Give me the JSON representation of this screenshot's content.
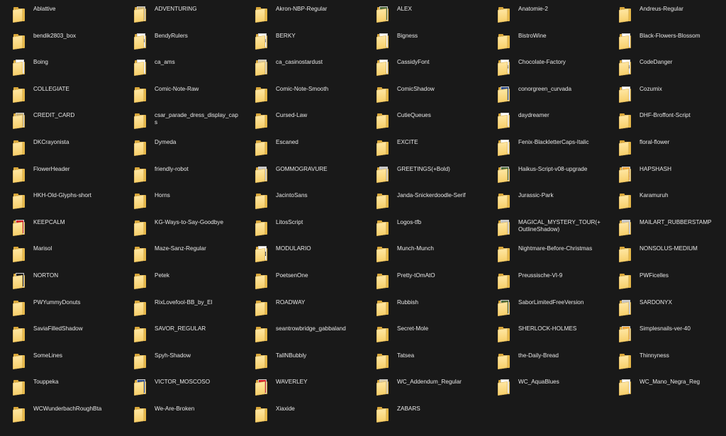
{
  "items": [
    {
      "name": "Ablattive",
      "glyph": "",
      "style": "plain"
    },
    {
      "name": "ADVENTURING",
      "glyph": "A",
      "style": "tan"
    },
    {
      "name": "Akron-NBP-Regular",
      "glyph": "",
      "style": "plain"
    },
    {
      "name": "ALEX",
      "glyph": "A",
      "style": "green"
    },
    {
      "name": "Anatomie-2",
      "glyph": "",
      "style": "plain"
    },
    {
      "name": "Andreus-Regular",
      "glyph": "",
      "style": "plain"
    },
    {
      "name": "bendik2803_box",
      "glyph": "",
      "style": "plain"
    },
    {
      "name": "BendyRulers",
      "glyph": "W",
      "style": "paper"
    },
    {
      "name": "BERKY",
      "glyph": "W",
      "style": "paper"
    },
    {
      "name": "Bigness",
      "glyph": "b",
      "style": "paper"
    },
    {
      "name": "BistroWine",
      "glyph": "",
      "style": "plain"
    },
    {
      "name": "Black-Flowers-Blossom",
      "glyph": "✿",
      "style": "paper"
    },
    {
      "name": "Boing",
      "glyph": "B",
      "style": "paper"
    },
    {
      "name": "ca_ams",
      "glyph": "a",
      "style": "paper"
    },
    {
      "name": "ca_casinostardust",
      "glyph": "a",
      "style": "beige"
    },
    {
      "name": "CassidyFont",
      "glyph": "a",
      "style": "paper"
    },
    {
      "name": "Chocolate-Factory",
      "glyph": "W",
      "style": "paper"
    },
    {
      "name": "CodeDanger",
      "glyph": "W",
      "style": "paper"
    },
    {
      "name": "COLLEGIATE",
      "glyph": "",
      "style": "plain"
    },
    {
      "name": "Comic-Note-Raw",
      "glyph": "",
      "style": "plain"
    },
    {
      "name": "Comic-Note-Smooth",
      "glyph": "",
      "style": "plain"
    },
    {
      "name": "ComicShadow",
      "glyph": "",
      "style": "plain"
    },
    {
      "name": "conorgreen_curvada",
      "glyph": "c",
      "style": "blue"
    },
    {
      "name": "Cozumix",
      "glyph": "c",
      "style": "paper"
    },
    {
      "name": "CREDIT_CARD",
      "glyph": "",
      "style": "tan"
    },
    {
      "name": "csar_parade_dress_display_caps",
      "glyph": "",
      "style": "plain"
    },
    {
      "name": "Cursed-Law",
      "glyph": "",
      "style": "plain"
    },
    {
      "name": "CutieQueues",
      "glyph": "",
      "style": "plain"
    },
    {
      "name": "daydreamer",
      "glyph": "A",
      "style": "paper"
    },
    {
      "name": "DHF-Broffont-Script",
      "glyph": "",
      "style": "plain"
    },
    {
      "name": "DKCrayonista",
      "glyph": "",
      "style": "plain"
    },
    {
      "name": "Dymeda",
      "glyph": "",
      "style": "plain"
    },
    {
      "name": "Escaned",
      "glyph": "",
      "style": "plain"
    },
    {
      "name": "EXCITE",
      "glyph": "",
      "style": "plain"
    },
    {
      "name": "Fenix-BlackletterCaps-Italic",
      "glyph": "C",
      "style": "paper"
    },
    {
      "name": "floral-flower",
      "glyph": "",
      "style": "plain"
    },
    {
      "name": "FlowerHeader",
      "glyph": "",
      "style": "plain"
    },
    {
      "name": "friendly-robot",
      "glyph": "",
      "style": "plain"
    },
    {
      "name": "GOMMOGRAVURE",
      "glyph": "G",
      "style": "gray"
    },
    {
      "name": "GREETINGS(+Bold)",
      "glyph": "",
      "style": "gray"
    },
    {
      "name": "Haikus-Script-v08-upgrade",
      "glyph": "",
      "style": "green"
    },
    {
      "name": "HAPSHASH",
      "glyph": "H",
      "style": "orange"
    },
    {
      "name": "HKH-Old-Glyphs-short",
      "glyph": "",
      "style": "plain"
    },
    {
      "name": "Horns",
      "glyph": "",
      "style": "plain"
    },
    {
      "name": "JacintoSans",
      "glyph": "",
      "style": "plain"
    },
    {
      "name": "Janda-Snickerdoodle-Serif",
      "glyph": "",
      "style": "plain"
    },
    {
      "name": "Jurassic-Park",
      "glyph": "",
      "style": "plain"
    },
    {
      "name": "Karamuruh",
      "glyph": "",
      "style": "plain"
    },
    {
      "name": "KEEPCALM",
      "glyph": "K",
      "style": "red"
    },
    {
      "name": "KG-Ways-to-Say-Goodbye",
      "glyph": "",
      "style": "plain"
    },
    {
      "name": "LitosScript",
      "glyph": "",
      "style": "plain"
    },
    {
      "name": "Logos-tfb",
      "glyph": "",
      "style": "plain"
    },
    {
      "name": "MAGICAL_MYSTERY_TOUR(+OutlineShadow)",
      "glyph": "",
      "style": "gray"
    },
    {
      "name": "MAILART_RUBBERSTAMP",
      "glyph": "",
      "style": "gray"
    },
    {
      "name": "Marisol",
      "glyph": "",
      "style": "plain"
    },
    {
      "name": "Maze-Sanz-Regular",
      "glyph": "",
      "style": "plain"
    },
    {
      "name": "MODULARIO",
      "glyph": "M",
      "style": "paper"
    },
    {
      "name": "Munch-Munch",
      "glyph": "",
      "style": "plain"
    },
    {
      "name": "Nightmare-Before-Christmas",
      "glyph": "",
      "style": "plain"
    },
    {
      "name": "NONSOLUS-MEDIUM",
      "glyph": "",
      "style": "plain"
    },
    {
      "name": "NORTON",
      "glyph": "N",
      "style": "dark"
    },
    {
      "name": "Petek",
      "glyph": "",
      "style": "plain"
    },
    {
      "name": "PoetsenOne",
      "glyph": "",
      "style": "plain"
    },
    {
      "name": "Pretty-tOmAtO",
      "glyph": "",
      "style": "plain"
    },
    {
      "name": "Preussische-VI-9",
      "glyph": "",
      "style": "plain"
    },
    {
      "name": "PWFicelles",
      "glyph": "",
      "style": "plain"
    },
    {
      "name": "PWYummyDonuts",
      "glyph": "",
      "style": "plain"
    },
    {
      "name": "RixLovefool-BB_by_El",
      "glyph": "",
      "style": "plain"
    },
    {
      "name": "ROADWAY",
      "glyph": "",
      "style": "plain"
    },
    {
      "name": "Rubbish",
      "glyph": "",
      "style": "plain"
    },
    {
      "name": "SaborLimitedFreeVersion",
      "glyph": "",
      "style": "green"
    },
    {
      "name": "SARDONYX",
      "glyph": "",
      "style": "gray"
    },
    {
      "name": "SaviaFilledShadow",
      "glyph": "",
      "style": "plain"
    },
    {
      "name": "SAVOR_REGULAR",
      "glyph": "",
      "style": "plain"
    },
    {
      "name": "seantrowbridge_gabbaland",
      "glyph": "",
      "style": "plain"
    },
    {
      "name": "Secret-Mole",
      "glyph": "",
      "style": "plain"
    },
    {
      "name": "SHERLOCK-HOLMES",
      "glyph": "",
      "style": "plain"
    },
    {
      "name": "Simplesnails-ver-40",
      "glyph": "",
      "style": "orange"
    },
    {
      "name": "SomeLines",
      "glyph": "",
      "style": "plain"
    },
    {
      "name": "Spyh-Shadow",
      "glyph": "",
      "style": "plain"
    },
    {
      "name": "TallNBubbly",
      "glyph": "",
      "style": "plain"
    },
    {
      "name": "Tatsea",
      "glyph": "",
      "style": "plain"
    },
    {
      "name": "the-Daily-Bread",
      "glyph": "",
      "style": "plain"
    },
    {
      "name": "Thinnyness",
      "glyph": "",
      "style": "plain"
    },
    {
      "name": "Touppeka",
      "glyph": "",
      "style": "plain"
    },
    {
      "name": "VICTOR_MOSCOSO",
      "glyph": "",
      "style": "blue"
    },
    {
      "name": "WAVERLEY",
      "glyph": "",
      "style": "red"
    },
    {
      "name": "WC_Addendum_Regular",
      "glyph": "D",
      "style": "beige"
    },
    {
      "name": "WC_AquaBlues",
      "glyph": "B",
      "style": "paper"
    },
    {
      "name": "WC_Mano_Negra_Reg",
      "glyph": "l",
      "style": "paper"
    },
    {
      "name": "WCWunderbachRoughBta",
      "glyph": "",
      "style": "plain"
    },
    {
      "name": "We-Are-Broken",
      "glyph": "",
      "style": "plain"
    },
    {
      "name": "Xiaxide",
      "glyph": "",
      "style": "plain"
    },
    {
      "name": "ZABARS",
      "glyph": "",
      "style": "plain"
    }
  ]
}
